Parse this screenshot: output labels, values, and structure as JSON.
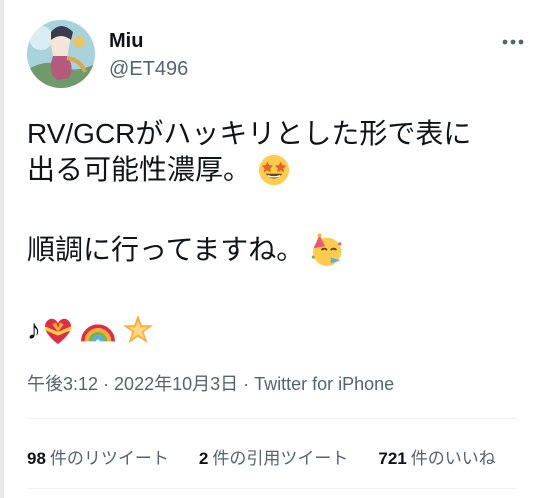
{
  "author": {
    "name": "Miu",
    "handle": "@ET496"
  },
  "icons": {
    "more": "more-horizontal-icon",
    "avatar": "illustrated-avatar"
  },
  "tweet": {
    "line1": "RV/GCRがハッキリとした形で表に",
    "line2": "出る可能性濃厚。",
    "line3": "順調に行ってますね。",
    "line4_prefix": "♪"
  },
  "meta": {
    "time": "午後3:12",
    "separator1": " · ",
    "date": "2022年10月3日",
    "separator2": " · ",
    "source": "Twitter for iPhone"
  },
  "stats": {
    "retweets_count": "98",
    "retweets_label": "件のリツイート",
    "quotes_count": "2",
    "quotes_label": "件の引用ツイート",
    "likes_count": "721",
    "likes_label": "件のいいね"
  },
  "colors": {
    "text": "#0f1419",
    "secondary": "#536471",
    "divider": "#eff3f4"
  }
}
